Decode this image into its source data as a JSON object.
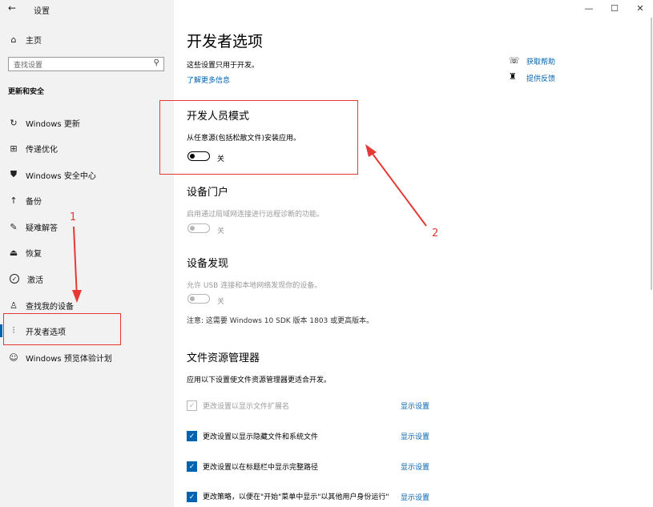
{
  "titlebar": {
    "back_glyph": "←",
    "title": "设置",
    "minimize": "—",
    "maximize": "☐",
    "close": "✕"
  },
  "sidebar": {
    "home_label": "主页",
    "search_placeholder": "查找设置",
    "section_title": "更新和安全",
    "items": [
      {
        "label": "Windows 更新",
        "icon": "sync-icon",
        "glyph": "↻"
      },
      {
        "label": "传递优化",
        "icon": "delivery-icon",
        "glyph": "⊞"
      },
      {
        "label": "Windows 安全中心",
        "icon": "shield-icon",
        "glyph": "⛊"
      },
      {
        "label": "备份",
        "icon": "backup-icon",
        "glyph": "↑"
      },
      {
        "label": "疑难解答",
        "icon": "wrench-icon",
        "glyph": "✎"
      },
      {
        "label": "恢复",
        "icon": "recovery-icon",
        "glyph": "⏏"
      },
      {
        "label": "激活",
        "icon": "activation-icon",
        "glyph": "✓"
      },
      {
        "label": "查找我的设备",
        "icon": "find-device-icon",
        "glyph": "♙"
      },
      {
        "label": "开发者选项",
        "icon": "developer-icon",
        "glyph": "⫶"
      },
      {
        "label": "Windows 预览体验计划",
        "icon": "insider-icon",
        "glyph": "☺"
      }
    ]
  },
  "main": {
    "title": "开发者选项",
    "intro": "这些设置只用于开发。",
    "learn_more": "了解更多信息",
    "help": {
      "get_help": "获取帮助",
      "feedback": "提供反馈"
    },
    "dev_mode": {
      "heading": "开发人员模式",
      "desc": "从任意源(包括松散文件)安装应用。",
      "state": "关"
    },
    "device_portal": {
      "heading": "设备门户",
      "desc": "启用通过局域网连接进行远程诊断的功能。",
      "state": "关"
    },
    "device_discovery": {
      "heading": "设备发现",
      "desc": "允许 USB 连接和本地网络发现你的设备。",
      "state": "关",
      "note": "注意: 这需要 Windows 10 SDK 版本 1803 或更高版本。"
    },
    "explorer": {
      "heading": "文件资源管理器",
      "desc": "应用以下设置使文件资源管理器更适合开发。",
      "show_settings": "显示设置",
      "items": [
        {
          "label": "更改设置以显示文件扩展名",
          "checked": false
        },
        {
          "label": "更改设置以显示隐藏文件和系统文件",
          "checked": true
        },
        {
          "label": "更改设置以在标题栏中显示完整路径",
          "checked": true
        },
        {
          "label": "更改策略，以便在\"开始\"菜单中显示\"以其他用户身份运行\"",
          "checked": true
        }
      ]
    }
  },
  "annotations": {
    "label1": "1",
    "label2": "2"
  },
  "colors": {
    "accent": "#0063b1",
    "annotation": "#e53935",
    "sidebar_bg": "#f2f2f2"
  }
}
